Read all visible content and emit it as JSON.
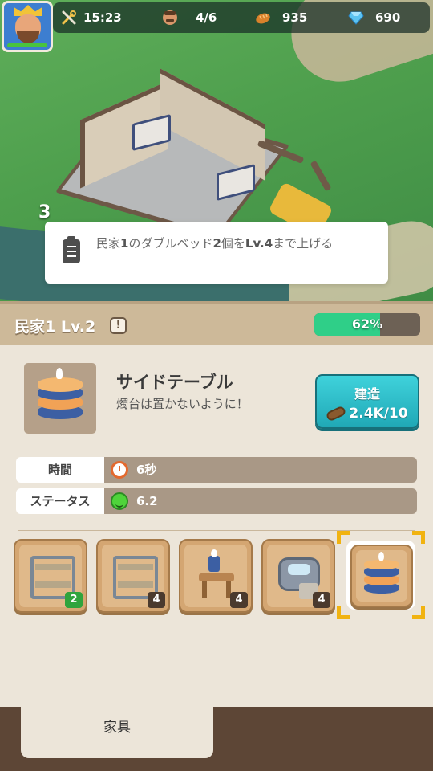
{
  "hud": {
    "time": "15:23",
    "residents": "4/6",
    "bread": "935",
    "gems": "690",
    "icons": [
      "tools-icon",
      "resident-face-icon",
      "bread-icon",
      "diamond-icon"
    ]
  },
  "quest": {
    "number": "3",
    "text_parts": [
      "民家",
      "1",
      "のダブルベッド",
      "2",
      "個を",
      "Lv.4",
      "まで上げる"
    ]
  },
  "panel": {
    "title": "民家1 Lv.2",
    "warn": "!",
    "progress_label": "62%",
    "progress": 0.62
  },
  "item": {
    "name": "サイドテーブル",
    "description": "燭台は置かないように！"
  },
  "build_button": {
    "label": "建造",
    "cost": "2.4K/10"
  },
  "stats": [
    {
      "key": "時間",
      "value": "6秒",
      "icon": "clock-icon"
    },
    {
      "key": "ステータス",
      "value": "6.2",
      "icon": "smiley-icon"
    }
  ],
  "slots": [
    {
      "name": "bunk-bed",
      "count": "2",
      "count_color": "green"
    },
    {
      "name": "bunk-bed",
      "count": "4"
    },
    {
      "name": "side-desk",
      "count": "4"
    },
    {
      "name": "stone-basin",
      "count": "4"
    },
    {
      "name": "side-table",
      "count": "",
      "selected": true
    }
  ],
  "tab": {
    "label": "家具"
  },
  "colors": {
    "progress_fill": "#2fcf88",
    "build_button": "#2bbcc7",
    "selection": "#f1b311",
    "count_green": "#2fa43d"
  }
}
